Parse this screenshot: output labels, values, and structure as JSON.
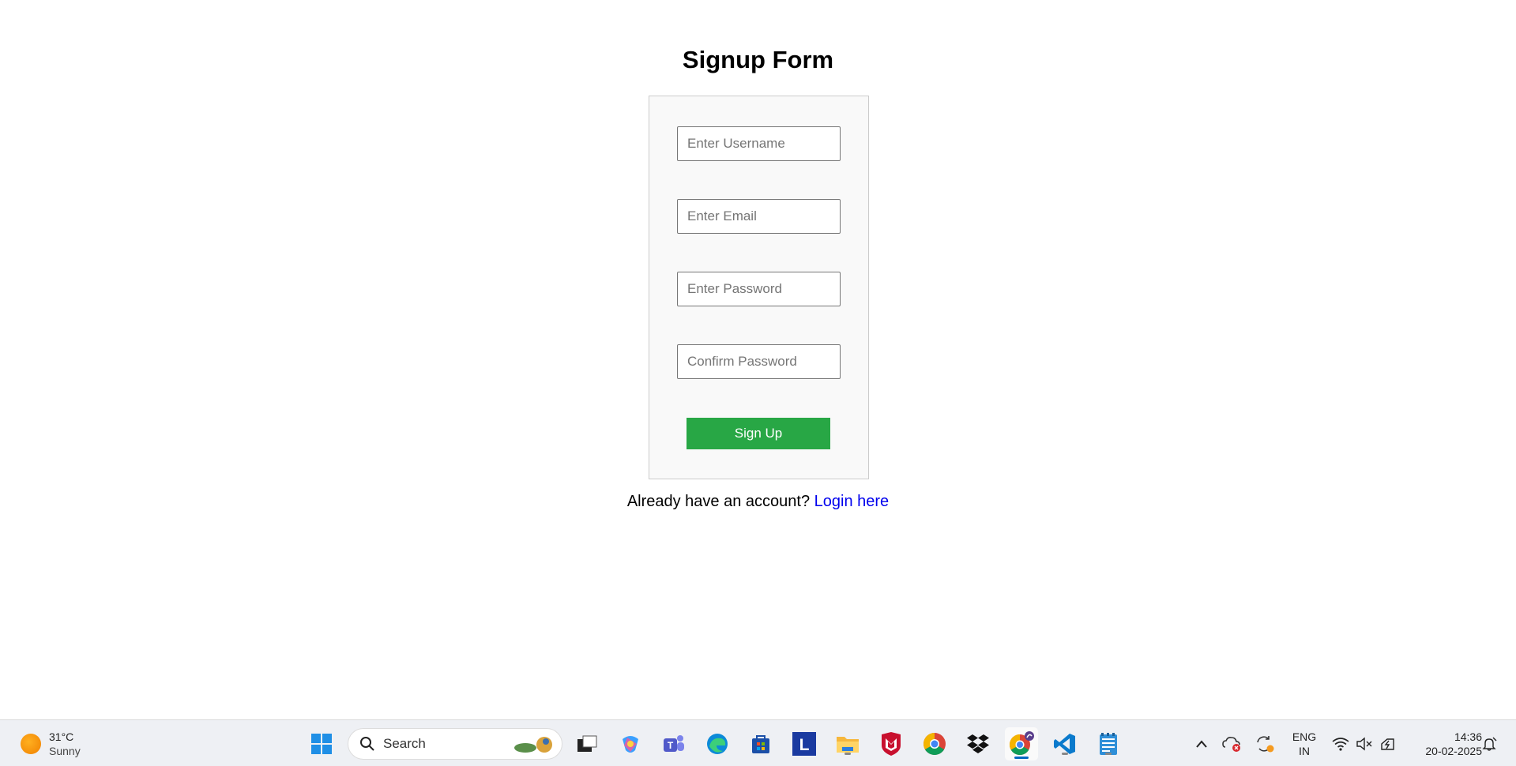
{
  "form": {
    "title": "Signup Form",
    "username_placeholder": "Enter Username",
    "email_placeholder": "Enter Email",
    "password_placeholder": "Enter Password",
    "confirm_placeholder": "Confirm Password",
    "submit_label": "Sign Up",
    "footer_text": "Already have an account?",
    "login_link": "Login here",
    "submit_color": "#28a745",
    "link_color": "#0000ee"
  },
  "taskbar": {
    "weather": {
      "temp": "31°C",
      "condition": "Sunny",
      "icon": "sun-icon"
    },
    "search_label": "Search",
    "apps": [
      "start-icon",
      "search-icon",
      "task-view-icon",
      "copilot-icon",
      "teams-icon",
      "edge-icon",
      "store-icon",
      "l-app-icon",
      "file-explorer-icon",
      "mcafee-icon",
      "chrome-icon",
      "dropbox-icon",
      "chrome-profile-icon",
      "vscode-icon",
      "notepad-icon"
    ],
    "tray": {
      "language_line1": "ENG",
      "language_line2": "IN",
      "time": "14:36",
      "date": "20-02-2025"
    }
  }
}
